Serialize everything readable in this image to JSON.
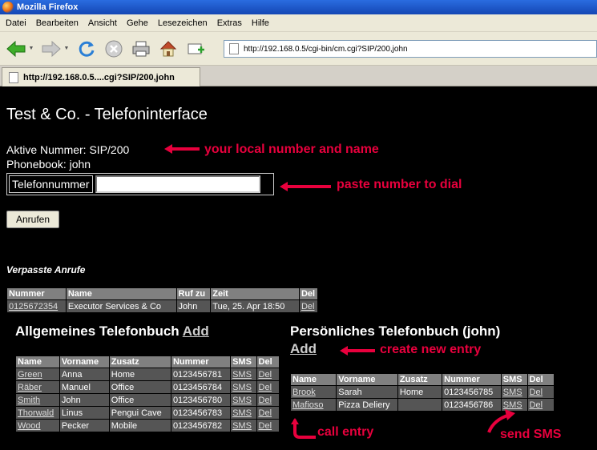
{
  "window": {
    "title": "Mozilla Firefox"
  },
  "menu": [
    "Datei",
    "Bearbeiten",
    "Ansicht",
    "Gehe",
    "Lesezeichen",
    "Extras",
    "Hilfe"
  ],
  "address": {
    "url": "http://192.168.0.5/cgi-bin/cm.cgi?SIP/200,john"
  },
  "tab": {
    "title": "http://192.168.0.5....cgi?SIP/200,john"
  },
  "page": {
    "title": "Test & Co. - Telefoninterface",
    "active_number": "Aktive Nummer: SIP/200",
    "phonebook": "Phonebook: john",
    "dial_label": "Telefonnummer",
    "dial_value": "",
    "call_button": "Anrufen",
    "missed_heading": "Verpasste Anrufe",
    "general_heading": "Allgemeines Telefonbuch",
    "personal_heading": "Persönliches Telefonbuch (john)",
    "add_label": "Add"
  },
  "missed": {
    "headers": [
      "Nummer",
      "Name",
      "Ruf zu",
      "Zeit",
      "Del"
    ],
    "rows": [
      [
        "0125672354",
        "Executor Services & Co",
        "John",
        "Tue, 25. Apr 18:50",
        "Del"
      ]
    ]
  },
  "general": {
    "headers": [
      "Name",
      "Vorname",
      "Zusatz",
      "Nummer",
      "SMS",
      "Del"
    ],
    "rows": [
      [
        "Green",
        "Anna",
        "Home",
        "0123456781",
        "SMS",
        "Del"
      ],
      [
        "Räber",
        "Manuel",
        "Office",
        "0123456784",
        "SMS",
        "Del"
      ],
      [
        "Smith",
        "John",
        "Office",
        "0123456780",
        "SMS",
        "Del"
      ],
      [
        "Thorwald",
        "Linus",
        "Pengui Cave",
        "0123456783",
        "SMS",
        "Del"
      ],
      [
        "Wood",
        "Pecker",
        "Mobile",
        "0123456782",
        "SMS",
        "Del"
      ]
    ]
  },
  "personal": {
    "headers": [
      "Name",
      "Vorname",
      "Zusatz",
      "Nummer",
      "SMS",
      "Del"
    ],
    "rows": [
      [
        "Brook",
        "Sarah",
        "Home",
        "0123456785",
        "SMS",
        "Del"
      ],
      [
        "Mafioso",
        "Pizza Deliery",
        "",
        "0123456786",
        "SMS",
        "Del"
      ]
    ]
  },
  "annotations": {
    "local": "your local number and name",
    "dial": "paste number to dial",
    "create": "create new entry",
    "call": "call entry",
    "sms": "send SMS",
    "color": "#e8003d"
  }
}
